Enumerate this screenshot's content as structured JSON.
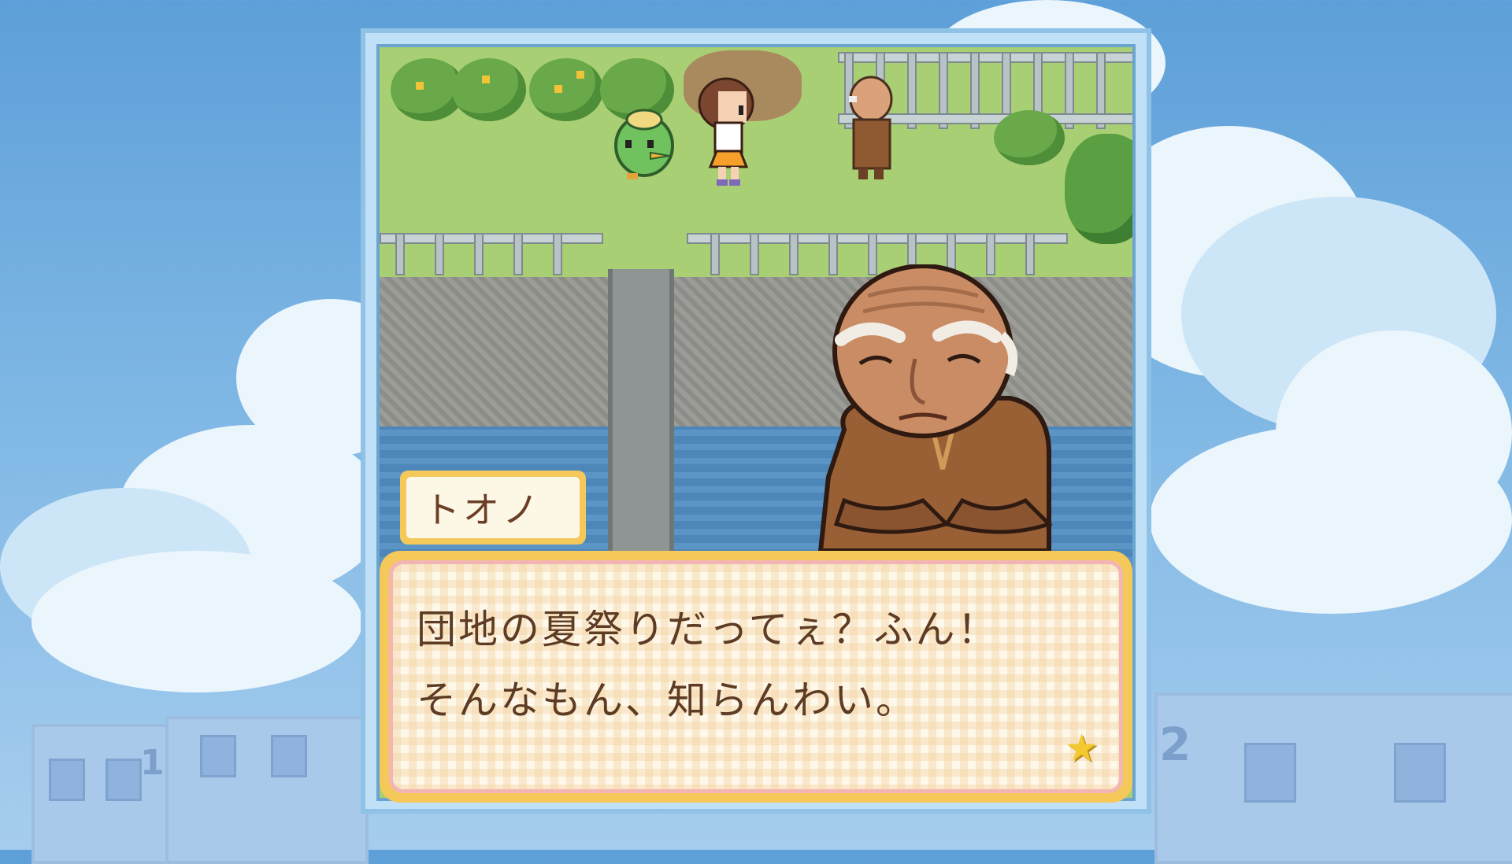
{
  "dialogue": {
    "speaker": "トオノ",
    "lines": [
      "団地の夏祭りだってぇ？ふん！",
      "そんなもん、知らんわい。"
    ],
    "advance_icon": "star-icon"
  },
  "background": {
    "building_numbers": [
      "1",
      "2"
    ]
  },
  "colors": {
    "sky": "#6fa9dd",
    "dialog_border": "#f5c85a",
    "dialog_text": "#5e3b23"
  }
}
